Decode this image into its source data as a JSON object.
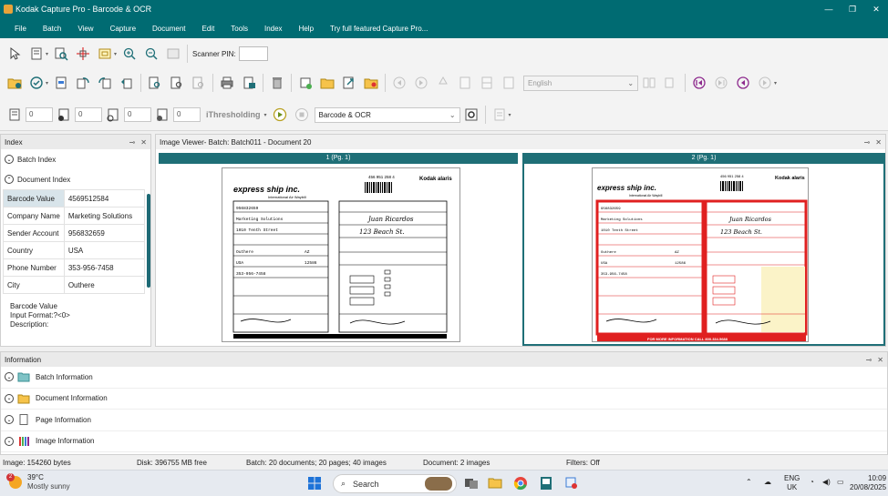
{
  "window": {
    "title": "Kodak Capture Pro - Barcode & OCR"
  },
  "menu": {
    "items": [
      "File",
      "Batch",
      "View",
      "Capture",
      "Document",
      "Edit",
      "Tools",
      "Index",
      "Help",
      "Try full featured Capture Pro..."
    ]
  },
  "toolbar": {
    "scanner_pin_label": "Scanner PIN:",
    "language_value": "English",
    "ithresholding_label": "iThresholding",
    "job_setup_value": "Barcode & OCR",
    "counter_values": [
      "0",
      "0",
      "0",
      "0"
    ]
  },
  "index_panel": {
    "title": "Index",
    "batch_index_label": "Batch Index",
    "document_index_label": "Document Index",
    "fields": [
      {
        "name": "Barcode Value",
        "value": "4569512584"
      },
      {
        "name": "Company Name",
        "value": "Marketing Solutions"
      },
      {
        "name": "Sender Account",
        "value": "956832659"
      },
      {
        "name": "Country",
        "value": "USA"
      },
      {
        "name": "Phone Number",
        "value": "353-956-7458"
      },
      {
        "name": "City",
        "value": "Outhere"
      }
    ],
    "description_lines": [
      "Barcode Value",
      "Input Format:?<0>",
      "Description:"
    ]
  },
  "image_viewer": {
    "title": "Image Viewer- Batch: Batch011 - Document 20",
    "images": [
      {
        "label": "1 (Pg. 1)",
        "mode": "bw"
      },
      {
        "label": "2 (Pg. 1)",
        "mode": "color"
      }
    ],
    "doc": {
      "tracking": "456 951 258 4",
      "brand": "express ship inc.",
      "subtitle": "International Air Waybill",
      "logo": "Kodak alaris",
      "account": "956832659",
      "company": "Marketing Solutions",
      "address": "1010 Tenth Street",
      "city": "Outhere",
      "state": "AZ",
      "country": "USA",
      "zip": "12586",
      "phone": "353-956-7458",
      "recipient": "Juan Ricardos",
      "to_address": "123 Beach St.",
      "footer": "FOR MORE INFORMATION CALL 800.334.5688"
    }
  },
  "info_panel": {
    "title": "Information",
    "rows": [
      "Batch Information",
      "Document Information",
      "Page Information",
      "Image Information"
    ]
  },
  "status": {
    "image": "Image: 154260 bytes",
    "disk": "Disk: 396755 MB free",
    "batch": "Batch: 20 documents; 20 pages; 40 images",
    "document": "Document: 2 images",
    "filters": "Filters: Off"
  },
  "taskbar": {
    "weather_badge": "2",
    "temperature": "39°C",
    "condition": "Mostly sunny",
    "search_placeholder": "Search",
    "lang_line1": "ENG",
    "lang_line2": "UK",
    "time": "10:09",
    "date": "20/08/2025"
  },
  "colors": {
    "accent": "#006b72",
    "header": "#1f6f77",
    "waybill_red": "#e02020"
  }
}
